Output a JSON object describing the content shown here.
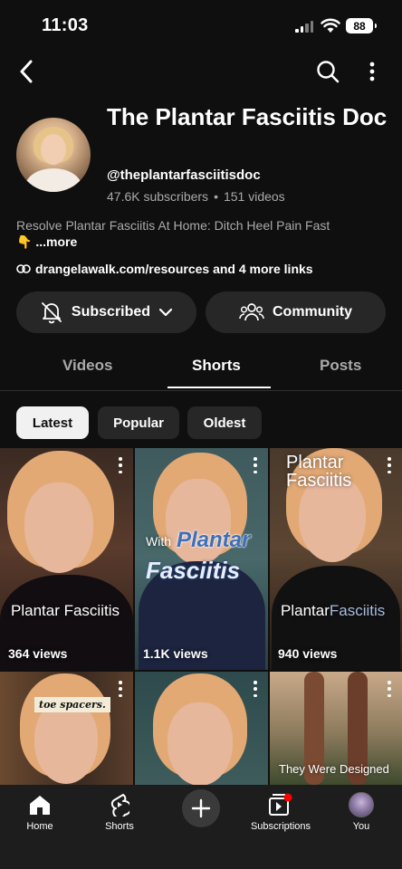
{
  "status_bar": {
    "time": "11:03",
    "battery": "88"
  },
  "channel": {
    "title": "The Plantar Fasciitis Doc",
    "handle": "@theplantarfasciitisdoc",
    "subscribers": "47.6K subscribers",
    "separator": "•",
    "videos": "151 videos",
    "description": "Resolve Plantar Fasciitis At Home: Ditch Heel Pain Fast",
    "description_emoji": "👇",
    "description_more": "...more",
    "links": "drangelawalk.com/resources and 4 more links"
  },
  "buttons": {
    "subscribed": "Subscribed",
    "community": "Community"
  },
  "tabs": [
    {
      "label": "Videos"
    },
    {
      "label": "Shorts"
    },
    {
      "label": "Posts"
    }
  ],
  "chips": [
    {
      "label": "Latest"
    },
    {
      "label": "Popular"
    },
    {
      "label": "Oldest"
    }
  ],
  "shorts": [
    {
      "views": "364 views",
      "overlay": "Plantar Fasciitis"
    },
    {
      "views": "1.1K views",
      "overlay_small": "With",
      "overlay_big": "Plantar",
      "overlay_big2": "Fasciitis"
    },
    {
      "views": "940 views",
      "overlay_top": "Plantar Fasciitis",
      "overlay_part1": "Plantar",
      "overlay_part2": "Fasciitis"
    },
    {
      "overlay": "toe spacers."
    },
    {},
    {
      "overlay": "They Were Designed"
    }
  ],
  "bottom_nav": [
    {
      "label": "Home",
      "icon": "home-icon"
    },
    {
      "label": "Shorts",
      "icon": "shorts-icon"
    },
    {
      "label": "",
      "icon": "create-icon"
    },
    {
      "label": "Subscriptions",
      "icon": "subscriptions-icon"
    },
    {
      "label": "You",
      "icon": "you-avatar"
    }
  ],
  "colors": {
    "background": "#0f0f0f",
    "button": "#272727",
    "muted_text": "#aaaaaa",
    "notification": "#ff0000"
  }
}
